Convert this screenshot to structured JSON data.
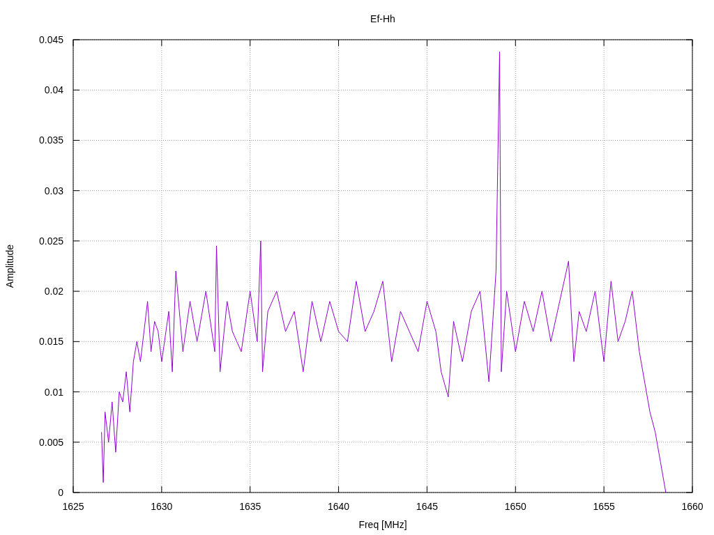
{
  "chart": {
    "chart_data": {
      "type": "line",
      "title": "Ef-Hh",
      "xlabel": "Freq [MHz]",
      "ylabel": "Amplitude",
      "xlim": [
        1625,
        1660
      ],
      "ylim": [
        0,
        0.045
      ],
      "xticks": [
        1625,
        1630,
        1635,
        1640,
        1645,
        1650,
        1655,
        1660
      ],
      "yticks": [
        {
          "value": 0,
          "label": "0"
        },
        {
          "value": 0.005,
          "label": "0.005"
        },
        {
          "value": 0.01,
          "label": "0.01"
        },
        {
          "value": 0.015,
          "label": "0.015"
        },
        {
          "value": 0.02,
          "label": "0.02"
        },
        {
          "value": 0.025,
          "label": "0.025"
        },
        {
          "value": 0.03,
          "label": "0.03"
        },
        {
          "value": 0.035,
          "label": "0.035"
        },
        {
          "value": 0.04,
          "label": "0.04"
        },
        {
          "value": 0.045,
          "label": "0.045"
        }
      ],
      "x": [
        1626.6,
        1626.7,
        1626.8,
        1627.0,
        1627.2,
        1627.4,
        1627.6,
        1627.8,
        1628.0,
        1628.2,
        1628.4,
        1628.6,
        1628.8,
        1629.0,
        1629.2,
        1629.4,
        1629.6,
        1629.8,
        1630.0,
        1630.4,
        1630.6,
        1630.8,
        1631.2,
        1631.6,
        1632.0,
        1632.5,
        1633.0,
        1633.1,
        1633.3,
        1633.7,
        1634.0,
        1634.5,
        1635.0,
        1635.4,
        1635.6,
        1635.7,
        1636.0,
        1636.5,
        1637.0,
        1637.5,
        1638.0,
        1638.5,
        1639.0,
        1639.5,
        1640.0,
        1640.5,
        1641.0,
        1641.5,
        1642.0,
        1642.5,
        1643.0,
        1643.5,
        1644.0,
        1644.5,
        1645.0,
        1645.5,
        1645.8,
        1646.2,
        1646.5,
        1647.0,
        1647.5,
        1648.0,
        1648.5,
        1648.9,
        1649.1,
        1649.2,
        1649.5,
        1650.0,
        1650.5,
        1651.0,
        1651.5,
        1652.0,
        1652.5,
        1653.0,
        1653.3,
        1653.6,
        1654.0,
        1654.5,
        1655.0,
        1655.4,
        1655.8,
        1656.2,
        1656.6,
        1657.0,
        1657.3,
        1657.6,
        1657.9,
        1658.2,
        1658.5
      ],
      "grid": true,
      "series": [
        {
          "color": "#9400d3",
          "values": [
            0.006,
            0.001,
            0.008,
            0.005,
            0.009,
            0.004,
            0.01,
            0.009,
            0.012,
            0.008,
            0.013,
            0.015,
            0.013,
            0.016,
            0.019,
            0.014,
            0.017,
            0.016,
            0.013,
            0.018,
            0.012,
            0.022,
            0.014,
            0.019,
            0.015,
            0.02,
            0.014,
            0.0245,
            0.012,
            0.019,
            0.016,
            0.014,
            0.02,
            0.015,
            0.025,
            0.012,
            0.018,
            0.02,
            0.016,
            0.018,
            0.012,
            0.019,
            0.015,
            0.019,
            0.016,
            0.015,
            0.021,
            0.016,
            0.018,
            0.021,
            0.013,
            0.018,
            0.016,
            0.014,
            0.019,
            0.016,
            0.012,
            0.0095,
            0.017,
            0.013,
            0.018,
            0.02,
            0.011,
            0.022,
            0.0438,
            0.012,
            0.02,
            0.014,
            0.019,
            0.016,
            0.02,
            0.015,
            0.019,
            0.023,
            0.013,
            0.018,
            0.016,
            0.02,
            0.013,
            0.021,
            0.015,
            0.017,
            0.02,
            0.014,
            0.011,
            0.008,
            0.006,
            0.003,
            0.0
          ]
        }
      ]
    }
  }
}
